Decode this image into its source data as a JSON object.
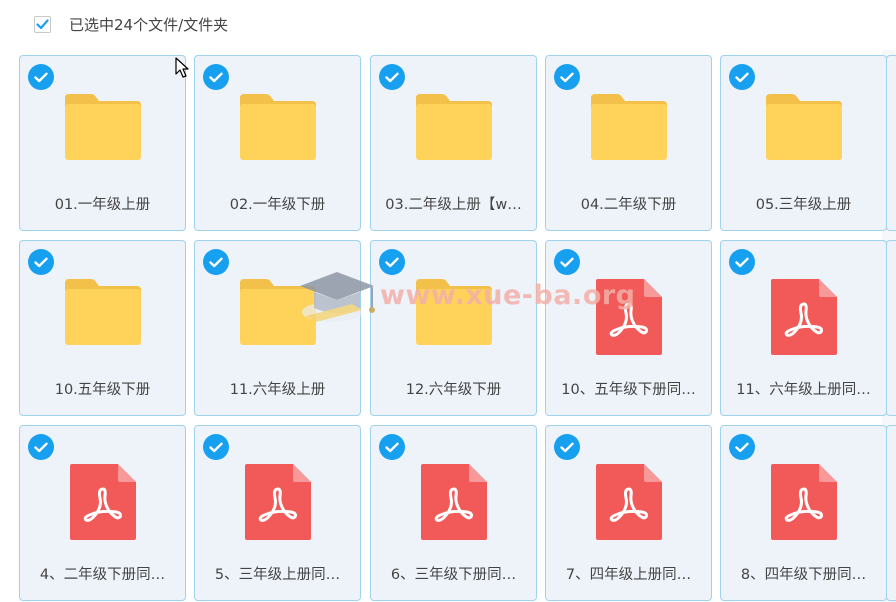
{
  "header": {
    "selection_label": "已选中24个文件/文件夹",
    "checked": true
  },
  "items": [
    {
      "name": "01.一年级上册",
      "type": "folder",
      "selected": true
    },
    {
      "name": "02.一年级下册",
      "type": "folder",
      "selected": true
    },
    {
      "name": "03.二年级上册【w…",
      "type": "folder",
      "selected": true
    },
    {
      "name": "04.二年级下册",
      "type": "folder",
      "selected": true
    },
    {
      "name": "05.三年级上册",
      "type": "folder",
      "selected": true
    },
    {
      "name": "10.五年级下册",
      "type": "folder",
      "selected": true
    },
    {
      "name": "11.六年级上册",
      "type": "folder",
      "selected": true
    },
    {
      "name": "12.六年级下册",
      "type": "folder",
      "selected": true
    },
    {
      "name": "10、五年级下册同…",
      "type": "pdf",
      "selected": true
    },
    {
      "name": "11、六年级上册同…",
      "type": "pdf",
      "selected": true
    },
    {
      "name": "4、二年级下册同…",
      "type": "pdf",
      "selected": true
    },
    {
      "name": "5、三年级上册同…",
      "type": "pdf",
      "selected": true
    },
    {
      "name": "6、三年级下册同…",
      "type": "pdf",
      "selected": true
    },
    {
      "name": "7、四年级上册同…",
      "type": "pdf",
      "selected": true
    },
    {
      "name": "8、四年级下册同…",
      "type": "pdf",
      "selected": true
    }
  ],
  "watermark": {
    "text": "www.xue-ba.org"
  },
  "colors": {
    "accent": "#18a0f0",
    "folder": "#ffd359",
    "folder_tab": "#f3c14a",
    "pdf": "#f25a5a",
    "card_bg": "#eef3fa",
    "card_border": "#9fd2ee"
  }
}
